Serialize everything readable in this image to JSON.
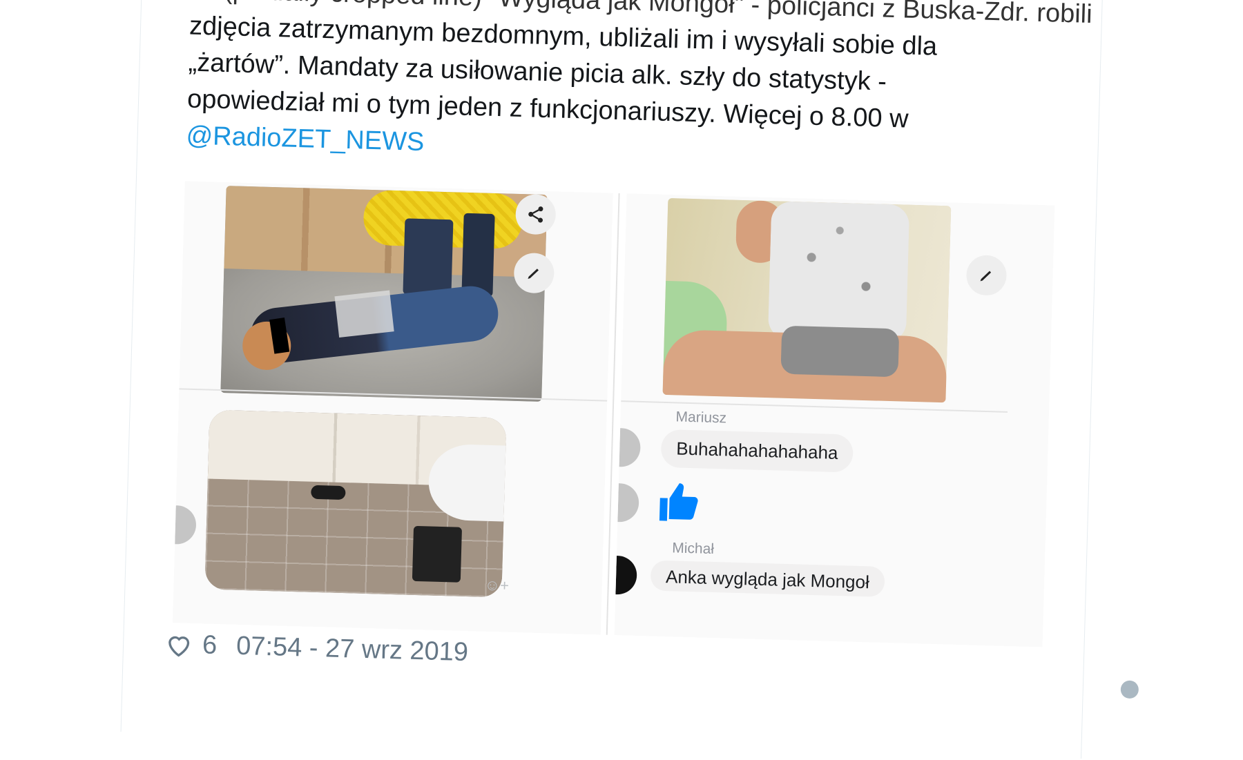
{
  "tweet": {
    "lines": [
      "… (partially cropped line) \"Wygląda jak Mongoł\" - policjanci z Buska-Zdr. robili",
      "zdjęcia zatrzymanym bezdomnym, ubliżali im i wysyłali sobie dla",
      "„żartów”. Mandaty za usiłowanie picia alk. szły do statystyk -",
      "opowiedział mi o tym jeden z funkcjonariuszy. Więcej o 8.00 w"
    ],
    "mention": "@RadioZET_NEWS"
  },
  "media": {
    "left_panel": {
      "share_icon": "share-icon",
      "edit_icon": "pencil-icon",
      "emoji_reaction": "☺+"
    },
    "right_panel": {
      "edit_icon": "pencil-icon",
      "messages": [
        {
          "sender": "Mariusz",
          "text": "Buhahahahahahaha"
        },
        {
          "sender": "",
          "text": "👍"
        },
        {
          "sender": "Michał",
          "text": "Anka wygląda jak Mongoł"
        }
      ]
    }
  },
  "footer": {
    "like_count": "6",
    "timestamp": "07:54 - 27 wrz 2019"
  },
  "colors": {
    "text": "#14171a",
    "mention": "#1b95e0",
    "meta": "#657786",
    "messenger_blue": "#0084ff"
  }
}
